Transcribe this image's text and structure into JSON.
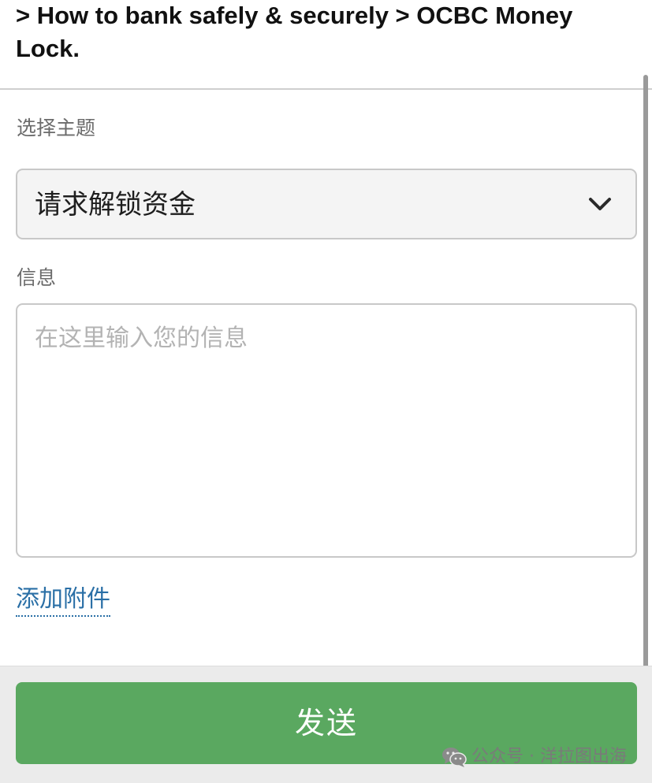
{
  "breadcrumb": {
    "text": "> How to bank safely & securely > OCBC Money Lock."
  },
  "form": {
    "topic_label": "选择主题",
    "topic_select": {
      "value": "请求解锁资金",
      "icon": "chevron-down-icon"
    },
    "message_label": "信息",
    "message_input": {
      "placeholder": "在这里输入您的信息",
      "value": ""
    },
    "attach_link": "添加附件"
  },
  "footer": {
    "send_label": "发送"
  },
  "watermark": {
    "icon": "wechat-icon",
    "text": "公众号 · 洋拉图出海"
  },
  "colors": {
    "send_button": "#5aa860",
    "link": "#2a6fa6",
    "select_bg": "#f4f4f4",
    "footer_bg": "#ebebeb"
  }
}
